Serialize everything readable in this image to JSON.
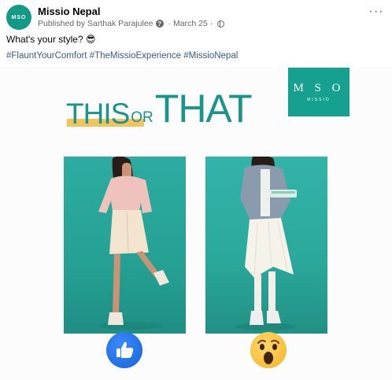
{
  "post": {
    "page_name": "Missio Nepal",
    "avatar_text": "MSO",
    "published_by": "Published by Sarthak Parajulee",
    "date": "March 25",
    "caption": "What's your style? 😎",
    "hashtags": [
      "#FlauntYourComfort",
      "#TheMissioExperience",
      "#MissioNepal"
    ],
    "more_label": "···"
  },
  "image": {
    "title_this": "THIS",
    "title_or": "OR",
    "title_that": "THAT",
    "logo_mark": "M S O",
    "logo_sub": "MISSIO",
    "colors": {
      "teal": "#15a08f",
      "yellow": "#f3c35c",
      "like_blue": "#1877f2",
      "wow_yellow": "#f7b125"
    },
    "reactions": [
      "like-icon",
      "wow-icon"
    ]
  }
}
